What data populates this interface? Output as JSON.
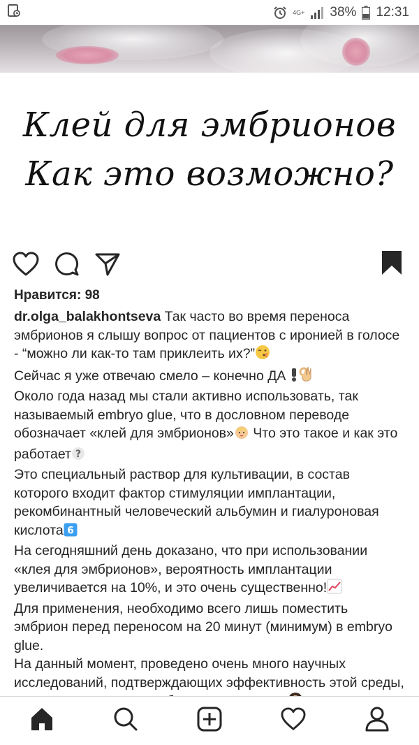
{
  "status_bar": {
    "network": "4G+",
    "battery": "38%",
    "time": "12:31"
  },
  "post": {
    "image_title_line1": "Клей для эмбрионов",
    "image_title_line2": "Как это возможно?",
    "likes_label": "Нравится: 98",
    "username": "dr.olga_balakhontseva",
    "caption_paragraphs": [
      "Так часто во время переноса эмбрионов я слышу вопрос от пациентов с иронией в голосе - “можно ли как-то там приклеить их?”",
      "Сейчас я уже отвечаю смело – конечно ДА ",
      "Около года назад мы стали активно использовать, так называемый embryo glue, что в дословном переводе обозначает «клей для эмбрионов»",
      " Что это такое и как это работает",
      "Это специальный раствор для культивации, в состав которого входит фактор стимуляции имплантации, рекомбинантный человеческий альбумин и гиалуроновая кислота",
      "На сегодняшний день доказано, что при использовании «клея для эмбрионов», вероятность имплантации увеличивается на 10%, и это очень существенно!",
      "Для применения, необходимо всего лишь поместить эмбрион перед переносом на 20 минут (минимум) в embryo glue.",
      "На данный момент, проведено очень много научных исследований, подтверждающих эффективность этой среды, но я поделюсь своим собственным опытом"
    ]
  },
  "icons": {
    "like": "heart-icon",
    "comment": "comment-icon",
    "share": "send-icon",
    "save": "bookmark-icon",
    "nav": [
      "home-icon",
      "search-icon",
      "add-post-icon",
      "activity-heart-icon",
      "profile-icon"
    ]
  },
  "colors": {
    "text": "#262626",
    "icon": "#262626",
    "emoji_yellow": "#f7c844",
    "emoji_blue": "#3b9ff0"
  }
}
